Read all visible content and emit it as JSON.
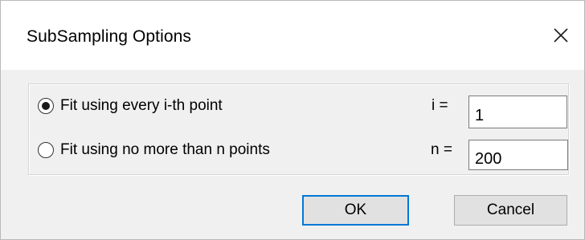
{
  "dialog": {
    "title": "SubSampling Options",
    "close_icon": "close-icon"
  },
  "options": [
    {
      "label": "Fit using every i-th point",
      "checked": true,
      "param_label": "i =",
      "param_value": "1"
    },
    {
      "label": "Fit using no more than n points",
      "checked": false,
      "param_label": "n =",
      "param_value": "200"
    }
  ],
  "buttons": {
    "ok_label": "OK",
    "cancel_label": "Cancel"
  },
  "colors": {
    "dialog_bg": "#f0f0f0",
    "title_bg": "#ffffff",
    "default_button_border": "#0078d7",
    "button_bg": "#e1e1e1"
  }
}
